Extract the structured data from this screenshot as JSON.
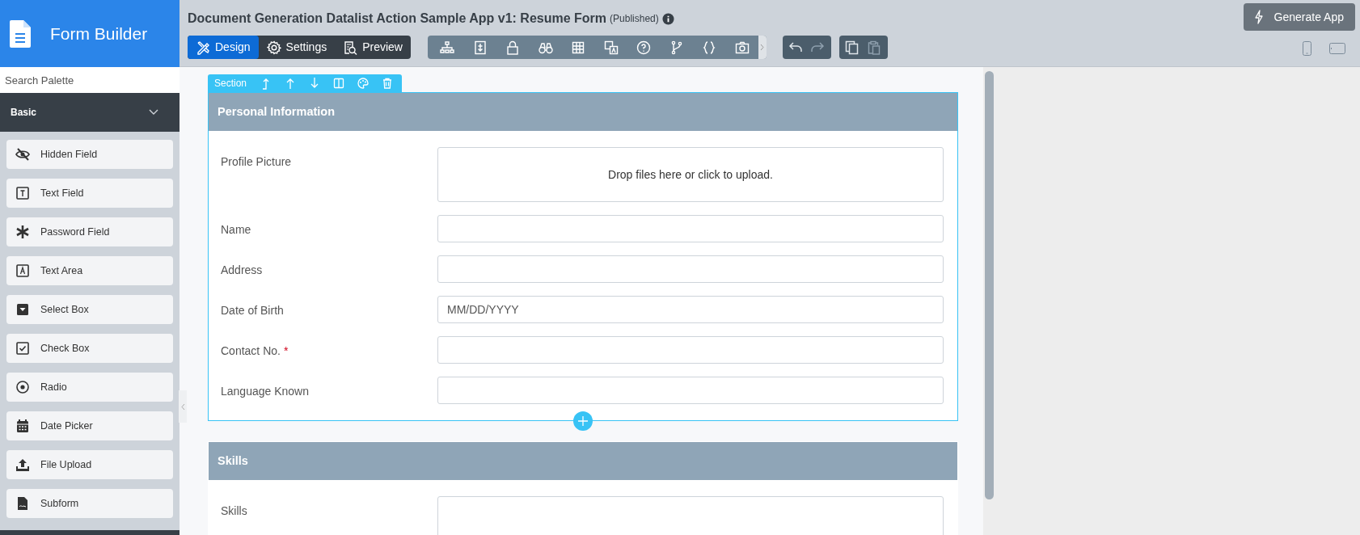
{
  "sidebar": {
    "title": "Form Builder",
    "search": {
      "placeholder": "Search Palette"
    },
    "category": {
      "label": "Basic",
      "expanded": true
    },
    "items": [
      {
        "label": "Hidden Field",
        "kind": "hidden"
      },
      {
        "label": "Text Field",
        "kind": "text"
      },
      {
        "label": "Password Field",
        "kind": "password"
      },
      {
        "label": "Text Area",
        "kind": "textarea"
      },
      {
        "label": "Select Box",
        "kind": "select"
      },
      {
        "label": "Check Box",
        "kind": "checkbox"
      },
      {
        "label": "Radio",
        "kind": "radio"
      },
      {
        "label": "Date Picker",
        "kind": "date"
      },
      {
        "label": "File Upload",
        "kind": "upload"
      },
      {
        "label": "Subform",
        "kind": "subform"
      }
    ]
  },
  "header": {
    "title": "Document Generation Datalist Action Sample App v1: Resume Form",
    "status": "(Published)",
    "generate_button": "Generate App",
    "tabs": [
      {
        "label": "Design",
        "kind": "design",
        "selected": true
      },
      {
        "label": "Settings",
        "kind": "settings",
        "selected": false
      },
      {
        "label": "Preview",
        "kind": "preview",
        "selected": false
      }
    ]
  },
  "section_toolbar": {
    "label": "Section"
  },
  "sections": [
    {
      "title": "Personal Information",
      "selected": true,
      "fields": [
        {
          "label": "Profile Picture",
          "kind": "dropzone",
          "text": "Drop files here or click to upload."
        },
        {
          "label": "Name",
          "kind": "input"
        },
        {
          "label": "Address",
          "kind": "input"
        },
        {
          "label": "Date of Birth",
          "kind": "input",
          "placeholder": "MM/DD/YYYY"
        },
        {
          "label": "Contact No.",
          "kind": "input",
          "required_mark": "*"
        },
        {
          "label": "Language Known",
          "kind": "input"
        }
      ]
    },
    {
      "title": "Skills",
      "selected": false,
      "fields": [
        {
          "label": "Skills",
          "kind": "textarea"
        }
      ]
    }
  ]
}
